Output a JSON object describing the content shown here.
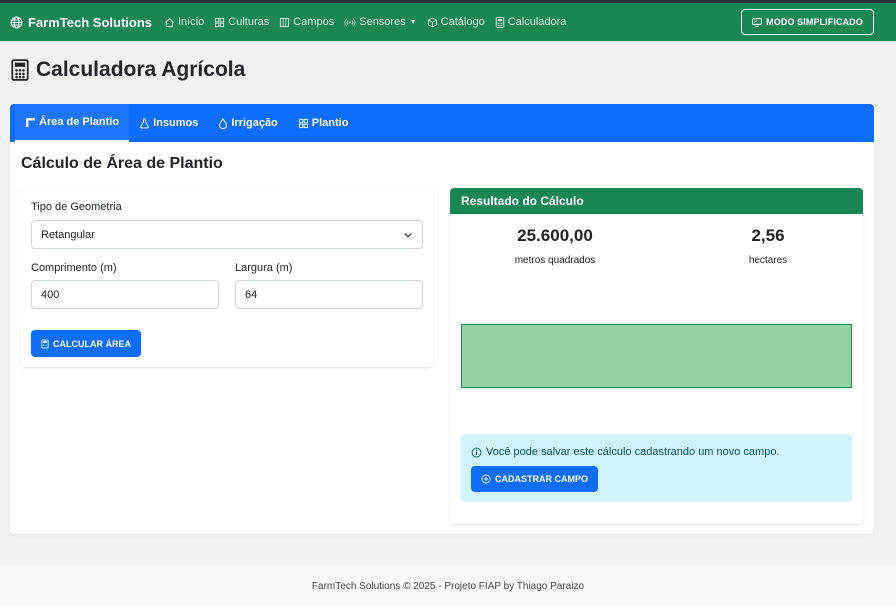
{
  "navbar": {
    "brand": "FarmTech Solutions",
    "items": [
      {
        "label": "Início",
        "icon": "house-icon"
      },
      {
        "label": "Culturas",
        "icon": "grid-icon"
      },
      {
        "label": "Campos",
        "icon": "columns-icon"
      },
      {
        "label": "Sensores",
        "icon": "broadcast-icon",
        "dropdown": true
      },
      {
        "label": "Catálogo",
        "icon": "box-icon"
      },
      {
        "label": "Calculadora",
        "icon": "calculator-icon"
      }
    ],
    "mode_button": "MODO SIMPLIFICADO"
  },
  "page": {
    "title": "Calculadora Agrícola"
  },
  "tabs": [
    {
      "label": "Área de Plantio",
      "icon": "area-icon",
      "active": true
    },
    {
      "label": "Insumos",
      "icon": "flask-icon",
      "active": false
    },
    {
      "label": "Irrigação",
      "icon": "droplet-icon",
      "active": false
    },
    {
      "label": "Plantio",
      "icon": "grid-icon",
      "active": false
    }
  ],
  "section": {
    "title": "Cálculo de Área de Plantio"
  },
  "form": {
    "geometry_label": "Tipo de Geometria",
    "geometry_value": "Retangular",
    "length_label": "Comprimento (m)",
    "length_value": "400",
    "width_label": "Largura (m)",
    "width_value": "64",
    "calc_button": "CALCULAR ÁREA"
  },
  "result": {
    "header": "Resultado do Cálculo",
    "square_meters_value": "25.600,00",
    "square_meters_label": "metros quadrados",
    "hectares_value": "2,56",
    "hectares_label": "hectares",
    "info_text": "Você pode salvar este cálculo cadastrando um novo campo.",
    "register_button": "CADASTRAR CAMPO"
  },
  "footer": {
    "text": "FarmTech Solutions © 2025 - Projeto FIAP by Thiago Paraizo"
  },
  "colors": {
    "navbar": "#198754",
    "primary": "#0d6efd",
    "result_header": "#198754",
    "area_fill": "#93d3a2",
    "info_bg": "#cff4fc"
  }
}
